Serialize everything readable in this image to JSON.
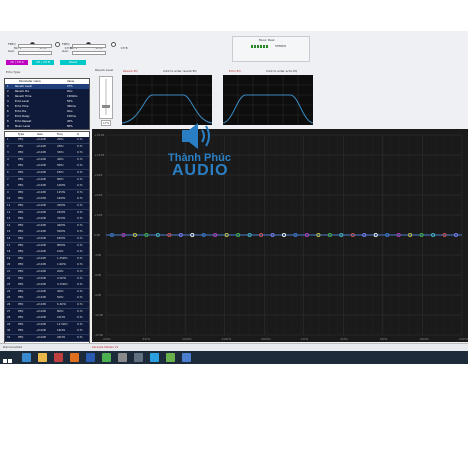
{
  "top": {
    "ch_a_label": "Mic 1",
    "ch_a_opt1": "CH A",
    "ch_a_opt2": "CH B",
    "ch_b_label": "Mic 2",
    "ch_b_opt1": "CH A",
    "ch_b_opt2": "CH B",
    "freq_label": "FREQ",
    "gain_label": "Gain",
    "btn1": "Ch / CH A",
    "btn2": "CH / CH B",
    "btn3": "Reset",
    "music_peak_label": "Music Peak",
    "stereo_label": "STEREO"
  },
  "echo": {
    "echo_type_label": "Echo Type",
    "mono": "Mono",
    "stereo": "Stereo",
    "reverb_level_label": "Reverb Level",
    "reverb_value": "17%",
    "reverb_eq_title": "Reverb EQ",
    "reverb_eq_hint": "Click to enter reverb EQ",
    "echo_eq_title": "Echo EQ",
    "echo_eq_hint": "Click to enter echo EQ"
  },
  "params": {
    "headers": [
      "Parameter name",
      "Value"
    ],
    "rows": [
      [
        "Reverb Level",
        "37%"
      ],
      [
        "Reverb Pre",
        "0ms"
      ],
      [
        "Reverb Time",
        "1500ms"
      ],
      [
        "Echo Level",
        "50%"
      ],
      [
        "Echo Time",
        "300ms"
      ],
      [
        "Echo Pre",
        "0ms"
      ],
      [
        "Echo Delay",
        "100ms"
      ],
      [
        "Echo Repeat",
        "40%"
      ],
      [
        "Music Level",
        "80%"
      ]
    ]
  },
  "peq": {
    "headers": [
      "",
      "Type",
      "Gain",
      "Freq",
      "Q"
    ],
    "rows": [
      [
        "1",
        "PEQ",
        "+0.0dB",
        "20Hz",
        "0.71"
      ],
      [
        "2",
        "PEQ",
        "+0.0dB",
        "25Hz",
        "0.71"
      ],
      [
        "3",
        "PEQ",
        "+0.0dB",
        "32Hz",
        "0.71"
      ],
      [
        "4",
        "PEQ",
        "+0.0dB",
        "40Hz",
        "0.71"
      ],
      [
        "5",
        "PEQ",
        "+0.0dB",
        "50Hz",
        "0.71"
      ],
      [
        "6",
        "PEQ",
        "+0.0dB",
        "63Hz",
        "0.71"
      ],
      [
        "7",
        "PEQ",
        "+0.0dB",
        "80Hz",
        "0.71"
      ],
      [
        "8",
        "PEQ",
        "+0.0dB",
        "100Hz",
        "0.71"
      ],
      [
        "9",
        "PEQ",
        "+0.0dB",
        "125Hz",
        "0.71"
      ],
      [
        "10",
        "PEQ",
        "+0.0dB",
        "160Hz",
        "0.71"
      ],
      [
        "11",
        "PEQ",
        "+0.0dB",
        "200Hz",
        "0.71"
      ],
      [
        "12",
        "PEQ",
        "+0.0dB",
        "250Hz",
        "0.71"
      ],
      [
        "13",
        "PEQ",
        "+0.0dB",
        "315Hz",
        "0.71"
      ],
      [
        "14",
        "PEQ",
        "+0.0dB",
        "400Hz",
        "0.71"
      ],
      [
        "15",
        "PEQ",
        "+0.0dB",
        "500Hz",
        "0.71"
      ],
      [
        "16",
        "PEQ",
        "+0.0dB",
        "630Hz",
        "0.71"
      ],
      [
        "17",
        "PEQ",
        "+0.0dB",
        "800Hz",
        "0.71"
      ],
      [
        "18",
        "PEQ",
        "+0.0dB",
        "1kHz",
        "0.71"
      ],
      [
        "19",
        "PEQ",
        "+0.0dB",
        "1.25kHz",
        "0.71"
      ],
      [
        "20",
        "PEQ",
        "+0.0dB",
        "1.6kHz",
        "0.71"
      ],
      [
        "21",
        "PEQ",
        "+0.0dB",
        "2kHz",
        "0.71"
      ],
      [
        "22",
        "PEQ",
        "+0.0dB",
        "2.5kHz",
        "0.71"
      ],
      [
        "23",
        "PEQ",
        "+0.0dB",
        "3.15kHz",
        "0.71"
      ],
      [
        "24",
        "PEQ",
        "+0.0dB",
        "4kHz",
        "0.71"
      ],
      [
        "25",
        "PEQ",
        "+0.0dB",
        "5kHz",
        "0.71"
      ],
      [
        "26",
        "PEQ",
        "+0.0dB",
        "6.3kHz",
        "0.71"
      ],
      [
        "27",
        "PEQ",
        "+0.0dB",
        "8kHz",
        "0.71"
      ],
      [
        "28",
        "PEQ",
        "+0.0dB",
        "10kHz",
        "0.71"
      ],
      [
        "29",
        "PEQ",
        "+0.0dB",
        "12.5kHz",
        "0.71"
      ],
      [
        "30",
        "PEQ",
        "+0.0dB",
        "16kHz",
        "0.71"
      ],
      [
        "31",
        "PEQ",
        "+0.0dB",
        "20kHz",
        "0.71"
      ]
    ]
  },
  "graph": {
    "y_labels": [
      "+15dB",
      "+12dB",
      "+9dB",
      "+6dB",
      "+3dB",
      "0dB",
      "-3dB",
      "-6dB",
      "-9dB",
      "-12dB",
      "-15dB"
    ],
    "x_labels": [
      "20Hz",
      "50Hz",
      "100Hz",
      "200Hz",
      "500Hz",
      "1kHz",
      "2kHz",
      "5kHz",
      "10kHz",
      "20kHz"
    ],
    "band_count": 31,
    "band_colors": [
      "#3a7bd5",
      "#c23ac2",
      "#d0d040",
      "#40c040",
      "#40c0c0",
      "#e05050",
      "#8080ff",
      "#ffffff"
    ]
  },
  "watermark": {
    "line1": "Thành Phúc",
    "line2": "AUDIO"
  },
  "status": {
    "left": "Disconnected",
    "mid": "Karaoke Master V1"
  },
  "taskbar": {
    "start_icon": "windows-logo-icon",
    "apps": [
      "ie-icon",
      "folder-icon",
      "media-icon",
      "firefox-icon",
      "word-icon",
      "chrome-icon",
      "tool-icon",
      "shield-icon",
      "skype-icon",
      "chat-icon",
      "app-icon"
    ]
  }
}
